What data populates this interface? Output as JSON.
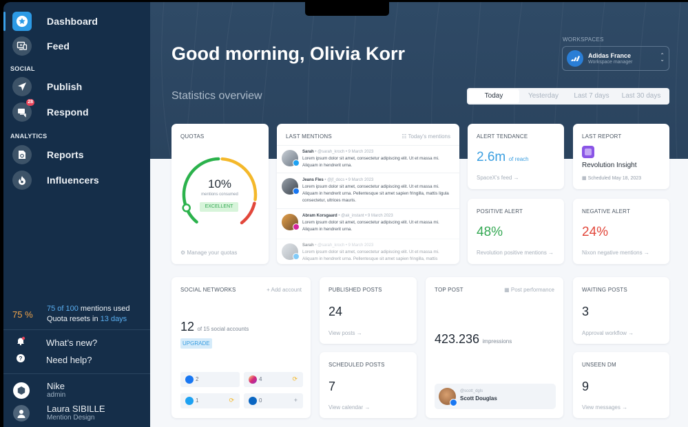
{
  "sidebar": {
    "nav": [
      {
        "label": "Dashboard",
        "icon": "star-icon",
        "active": true
      },
      {
        "label": "Feed",
        "icon": "monitor-icon"
      },
      {
        "label": "Publish",
        "icon": "paper-plane-icon"
      },
      {
        "label": "Respond",
        "icon": "chat-icon",
        "badge": "28"
      },
      {
        "label": "Reports",
        "icon": "report-icon"
      },
      {
        "label": "Influencers",
        "icon": "flame-icon"
      }
    ],
    "sections": {
      "social": "SOCIAL",
      "analytics": "ANALYTICS"
    },
    "quota": {
      "percent": "75 %",
      "used": "75 of 100",
      "used_suffix": " mentions used",
      "reset_prefix": "Quota resets in ",
      "reset_days": "13 days"
    },
    "utilities": [
      {
        "label": "What’s new?",
        "icon": "bell-icon"
      },
      {
        "label": "Need help?",
        "icon": "help-icon"
      }
    ],
    "accounts": [
      {
        "name": "Nike",
        "role": "admin"
      },
      {
        "name": "Laura SIBILLE",
        "role": "Mention Design"
      }
    ]
  },
  "header": {
    "greeting": "Good morning, Olivia Korr",
    "stats_title": "Statistics overview",
    "workspace": {
      "label": "WORKSPACES",
      "name": "Adidas France",
      "role": "Workspace manager"
    },
    "tabs": [
      {
        "label": "Today",
        "active": true
      },
      {
        "label": "Yesterday"
      },
      {
        "label": "Last 7 days"
      },
      {
        "label": "Last 30 days"
      }
    ]
  },
  "quotas": {
    "title": "QUOTAS",
    "percent": "10%",
    "subtitle": "mentions consumed",
    "status": "EXCELLENT",
    "link": "Manage your quotas",
    "value_fraction": 0.1,
    "colors": {
      "good": "#2bb24c",
      "warn": "#f4b82a",
      "bad": "#e2473b"
    }
  },
  "last_mentions": {
    "title": "LAST MENTIONS",
    "link": "Today's mentions",
    "items": [
      {
        "name": "Sarah",
        "handle": "@sarah_kroch",
        "date": "9 March 2023",
        "network": "twitter",
        "text": "Lorem ipsum dolor sit amet, consectetur adipiscing elit. Ut et massa mi. Aliquam in hendrerit urna."
      },
      {
        "name": "Jeans Fles",
        "handle": "@jf_docs",
        "date": "9 March 2023",
        "network": "facebook",
        "text": "Lorem ipsum dolor sit amet, consectetur adipiscing elit. Ut et massa mi. Aliquam in hendrerit urna. Pellentesque sit amet sapien fringilla, mattis ligula consectetur, ultrices mauris."
      },
      {
        "name": "Abram Korsgaard",
        "handle": "@ak_instant",
        "date": "9 March 2023",
        "network": "instagram",
        "text": "Lorem ipsum dolor sit amet, consectetur adipiscing elit. Ut et massa mi. Aliquam in hendrerit urna."
      },
      {
        "name": "Sarah",
        "handle": "@sarah_kroch",
        "date": "9 March 2023",
        "network": "twitter",
        "text": "Lorem ipsum dolor sit amet, consectetur adipiscing elit. Ut et massa mi. Aliquam in hendrerit urna. Pellentesque sit amet sapien fringilla, mattis"
      }
    ]
  },
  "alert_tendance": {
    "title": "ALERT TENDANCE",
    "value": "2.6m",
    "unit": "of reach",
    "link": "SpaceX's feed →"
  },
  "last_report": {
    "title": "LAST REPORT",
    "name": "Revolution Insight",
    "scheduled": "Scheduled May 18, 2023"
  },
  "positive_alert": {
    "title": "POSITIVE ALERT",
    "value": "48%",
    "link": "Revolution positive mentions →"
  },
  "negative_alert": {
    "title": "NEGATIVE ALERT",
    "value": "24%",
    "link": "Nixon negative mentions →"
  },
  "social_networks": {
    "title": "SOCIAL NETWORKS",
    "add": "+ Add account",
    "count": "12",
    "count_suffix": "of 15 social accounts",
    "upgrade": "UPGRADE",
    "networks": [
      {
        "name": "facebook",
        "count": "2",
        "action": ""
      },
      {
        "name": "instagram",
        "count": "4",
        "action": "sync"
      },
      {
        "name": "twitter",
        "count": "1",
        "action": "sync"
      },
      {
        "name": "linkedin",
        "count": "0",
        "action": "add"
      }
    ]
  },
  "published_posts": {
    "title": "PUBLISHED POSTS",
    "value": "24",
    "link": "View posts →"
  },
  "scheduled_posts": {
    "title": "SCHEDULED POSTS",
    "value": "7",
    "link": "View calendar →"
  },
  "top_post": {
    "title": "TOP POST",
    "link": "Post performance",
    "value": "423.236",
    "unit": "impressions",
    "author_handle": "@scott_dgls",
    "author_name": "Scott Douglas"
  },
  "waiting_posts": {
    "title": "WAITING POSTS",
    "value": "3",
    "link": "Approval workflow →"
  },
  "unseen_dm": {
    "title": "UNSEEN DM",
    "value": "9",
    "link": "View messages →"
  }
}
